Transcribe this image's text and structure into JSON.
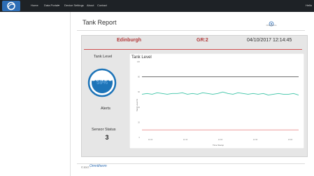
{
  "nav": {
    "items": [
      "Home",
      "Data Portal▾",
      "Device Settings",
      "About",
      "Contact"
    ],
    "user": "Hello"
  },
  "page": {
    "title": "Tank Report"
  },
  "report": {
    "location": "Edinburgh",
    "gr": "GR:2",
    "datetime": "04/10/2017 12:14:45",
    "tank_level_label": "Tank Level",
    "tank_level_value": "59%",
    "tank_level_fraction": 0.59,
    "alerts_label": "Alerts",
    "sensor_status_label": "Sensor Status",
    "sensor_status_value": "3"
  },
  "footer": {
    "copyright": "© 2017 -",
    "brand": "Omnitherm"
  },
  "colors": {
    "navbar": "#1e2226",
    "accent": "#b23a3a",
    "gauge": "#1d74b8",
    "level_line": "#3cc4a6",
    "upper_threshold": "#444444",
    "lower_threshold": "#e06060"
  },
  "chart_data": {
    "type": "line",
    "title": "Tank Level",
    "xlabel": "Time Stamp",
    "ylabel": "Tank Level %",
    "ylim": [
      0,
      100
    ],
    "yticks": [
      0,
      20,
      40,
      60,
      80,
      100
    ],
    "xticks": [
      "11:00",
      "11:30",
      "12:00",
      "12:30",
      "13:00"
    ],
    "grid": false,
    "series": [
      {
        "values": [
          57,
          58,
          57,
          59,
          58,
          57,
          58,
          58,
          59,
          57,
          58,
          57,
          59,
          58,
          57,
          58,
          60,
          58,
          57,
          59,
          58,
          57,
          58,
          57,
          58,
          56,
          57,
          58,
          57,
          57,
          58,
          56
        ],
        "color": "#3cc4a6"
      },
      {
        "values": [
          80,
          80
        ],
        "color": "#444444"
      },
      {
        "values": [
          10,
          10
        ],
        "color": "#e06060"
      }
    ]
  }
}
